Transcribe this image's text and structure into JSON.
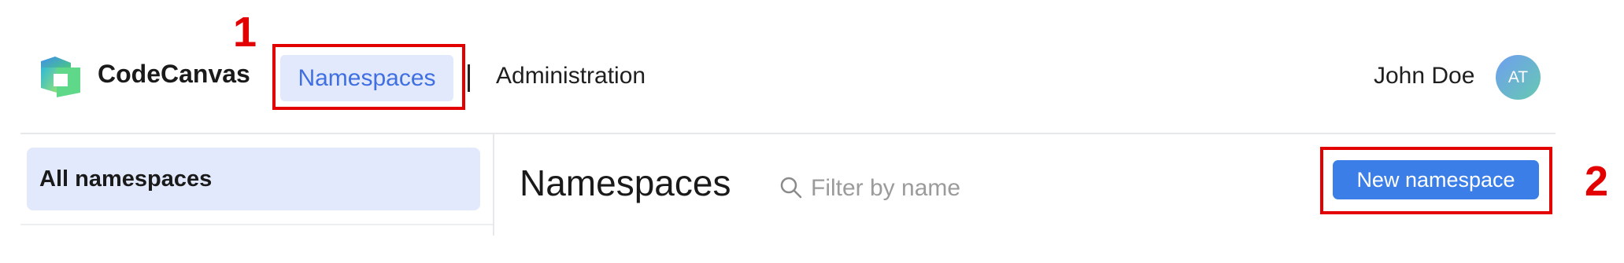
{
  "header": {
    "brand": "CodeCanvas",
    "logo_icon": "codecanvas-logo-icon",
    "nav": {
      "namespaces_label": "Namespaces",
      "administration_label": "Administration"
    },
    "user": {
      "name": "John Doe",
      "avatar_initials": "AT"
    }
  },
  "sidebar": {
    "items": [
      {
        "label": "All namespaces",
        "selected": true
      }
    ]
  },
  "main": {
    "title": "Namespaces",
    "search": {
      "placeholder": "Filter by name",
      "value": "",
      "icon": "search-icon"
    },
    "new_button_label": "New namespace"
  },
  "annotations": [
    {
      "label": "1",
      "target": "nav-namespaces-tab"
    },
    {
      "label": "2",
      "target": "new-namespace-button"
    }
  ],
  "colors": {
    "accent": "#3b7ee8",
    "selected_bg": "#e2e9fc",
    "annotation": "#e30000"
  }
}
